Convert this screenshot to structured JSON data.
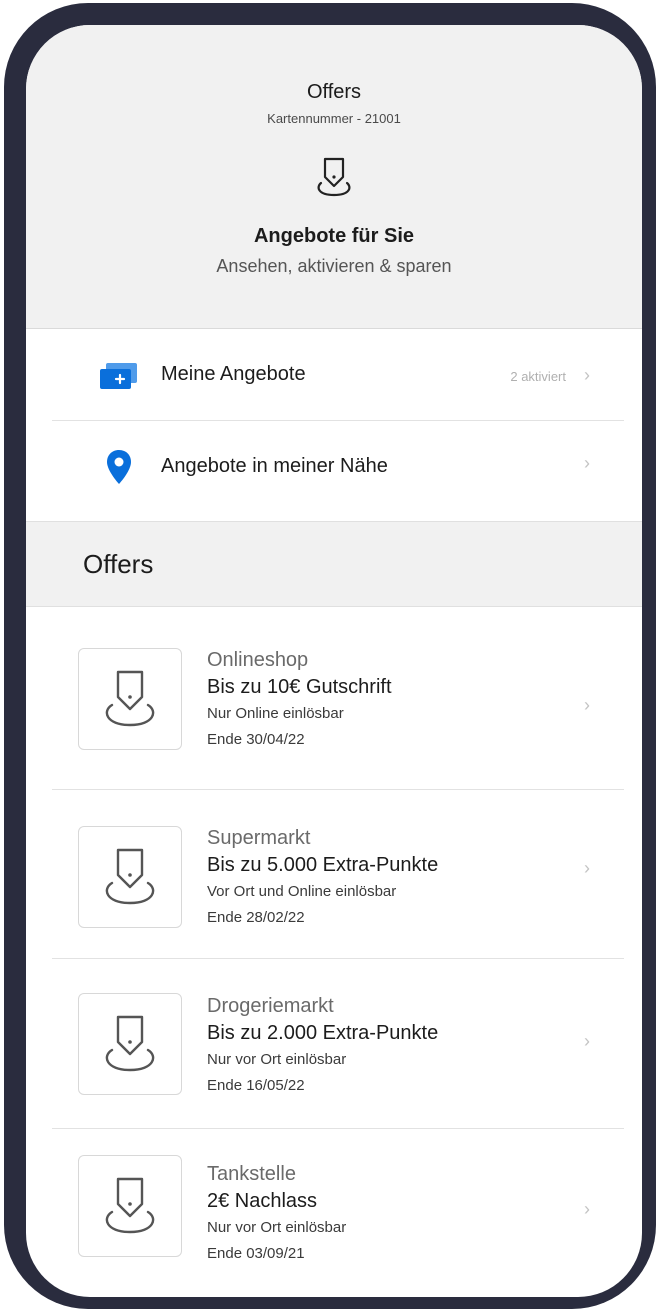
{
  "header": {
    "title": "Offers",
    "subtitle": "Kartennummer - 21001",
    "icon": "offer-tag-icon",
    "heading": "Angebote für Sie",
    "tagline": "Ansehen, aktivieren & sparen"
  },
  "menu": {
    "items": [
      {
        "label": "Meine Angebote",
        "meta": "2 aktiviert",
        "icon": "card-plus-icon"
      },
      {
        "label": "Angebote in meiner Nähe",
        "meta": "",
        "icon": "location-pin-icon"
      }
    ]
  },
  "section": {
    "title": "Offers"
  },
  "offers": [
    {
      "category": "Onlineshop",
      "title": "Bis zu 10€ Gutschrift",
      "note": "Nur Online einlösbar",
      "end": "Ende 30/04/22"
    },
    {
      "category": "Supermarkt",
      "title": "Bis zu 5.000 Extra-Punkte",
      "note": "Vor Ort und Online einlösbar",
      "end": "Ende 28/02/22"
    },
    {
      "category": "Drogeriemarkt",
      "title": "Bis zu 2.000 Extra-Punkte",
      "note": "Nur vor Ort einlösbar",
      "end": "Ende 16/05/22"
    },
    {
      "category": "Tankstelle",
      "title": "2€ Nachlass",
      "note": "Nur vor Ort einlösbar",
      "end": "Ende 03/09/21"
    }
  ],
  "colors": {
    "accent": "#0a6fdb",
    "device_frame": "#2a2c3e",
    "header_bg": "#f1f1f1"
  }
}
